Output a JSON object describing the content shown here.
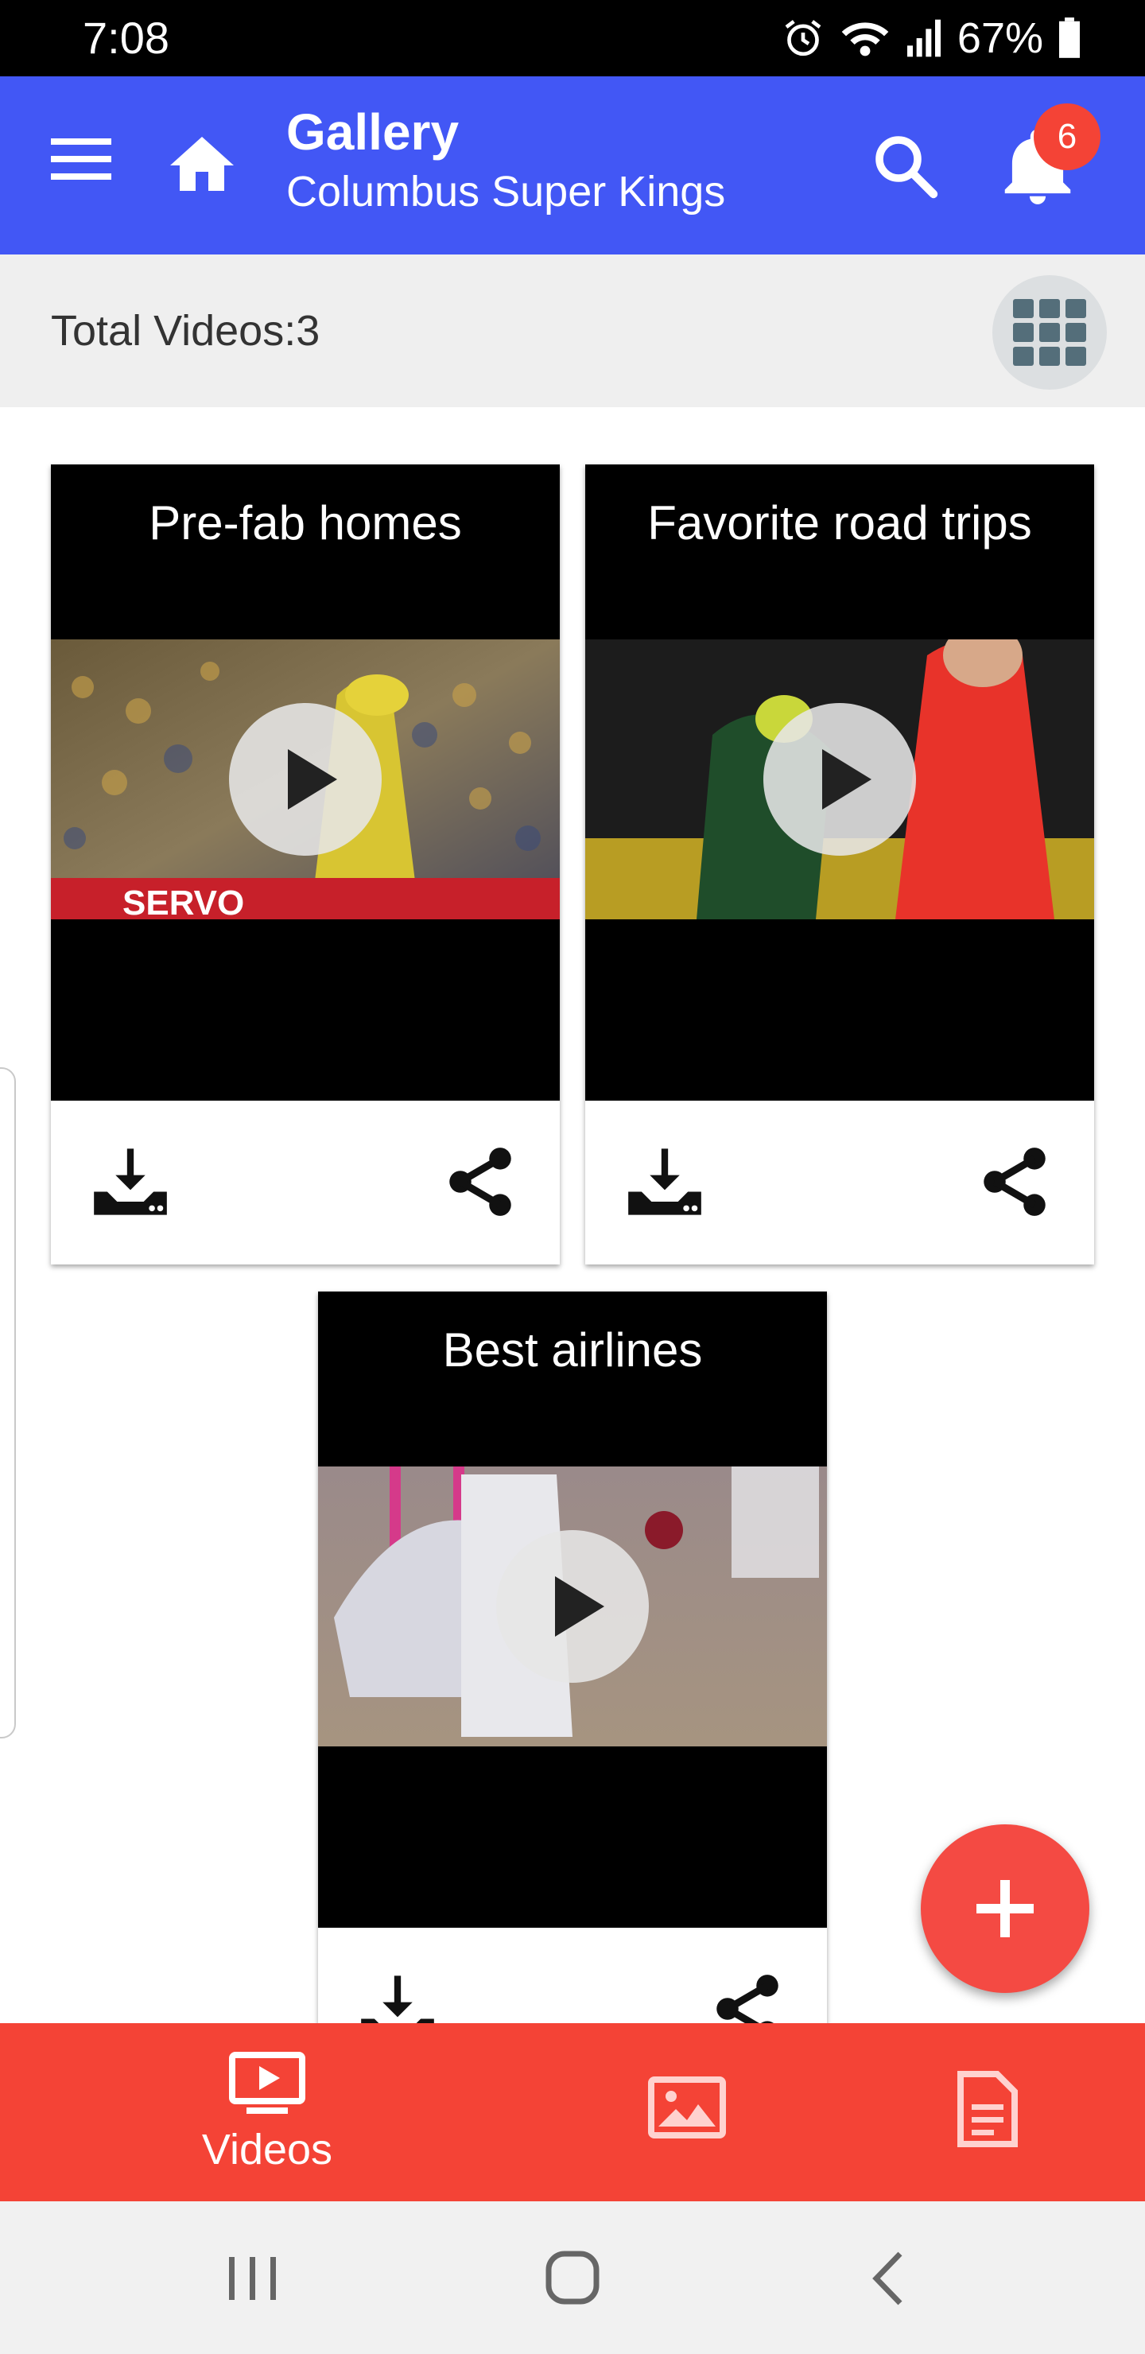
{
  "status_bar": {
    "time": "7:08",
    "battery": "67%",
    "icons": [
      "alarm-icon",
      "wifi-icon",
      "signal-icon",
      "battery-icon"
    ]
  },
  "app_bar": {
    "title": "Gallery",
    "subtitle": "Columbus Super Kings",
    "notification_count": "6",
    "color": "#4257f5",
    "icons": [
      "menu-icon",
      "home-icon",
      "search-icon",
      "bell-icon"
    ]
  },
  "info_bar": {
    "total_label": "Total Videos:3",
    "view_toggle_icon": "grid-view-icon"
  },
  "videos": [
    {
      "title": "Pre-fab homes",
      "actions": [
        "download-icon",
        "share-icon"
      ]
    },
    {
      "title": "Favorite road trips",
      "actions": [
        "download-icon",
        "share-icon"
      ]
    },
    {
      "title": "Best airlines",
      "actions": [
        "download-icon",
        "share-icon"
      ]
    }
  ],
  "fab": {
    "icon": "plus-icon",
    "color": "#f44a43"
  },
  "bottom_nav": {
    "color": "#f44336",
    "items": [
      {
        "label": "Videos",
        "icon": "video-library-icon",
        "selected": true
      },
      {
        "label": "",
        "icon": "image-icon",
        "selected": false
      },
      {
        "label": "",
        "icon": "document-icon",
        "selected": false
      }
    ]
  },
  "system_nav": {
    "icons": [
      "recent-apps-icon",
      "home-circle-icon",
      "back-icon"
    ]
  }
}
